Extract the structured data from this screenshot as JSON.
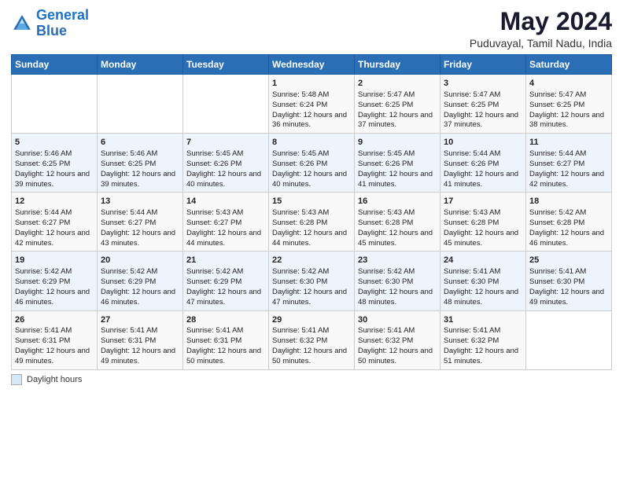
{
  "header": {
    "logo_line1": "General",
    "logo_line2": "Blue",
    "title": "May 2024",
    "subtitle": "Puduvayal, Tamil Nadu, India"
  },
  "columns": [
    "Sunday",
    "Monday",
    "Tuesday",
    "Wednesday",
    "Thursday",
    "Friday",
    "Saturday"
  ],
  "weeks": [
    [
      {
        "day": "",
        "sunrise": "",
        "sunset": "",
        "daylight": ""
      },
      {
        "day": "",
        "sunrise": "",
        "sunset": "",
        "daylight": ""
      },
      {
        "day": "",
        "sunrise": "",
        "sunset": "",
        "daylight": ""
      },
      {
        "day": "1",
        "sunrise": "Sunrise: 5:48 AM",
        "sunset": "Sunset: 6:24 PM",
        "daylight": "Daylight: 12 hours and 36 minutes."
      },
      {
        "day": "2",
        "sunrise": "Sunrise: 5:47 AM",
        "sunset": "Sunset: 6:25 PM",
        "daylight": "Daylight: 12 hours and 37 minutes."
      },
      {
        "day": "3",
        "sunrise": "Sunrise: 5:47 AM",
        "sunset": "Sunset: 6:25 PM",
        "daylight": "Daylight: 12 hours and 37 minutes."
      },
      {
        "day": "4",
        "sunrise": "Sunrise: 5:47 AM",
        "sunset": "Sunset: 6:25 PM",
        "daylight": "Daylight: 12 hours and 38 minutes."
      }
    ],
    [
      {
        "day": "5",
        "sunrise": "Sunrise: 5:46 AM",
        "sunset": "Sunset: 6:25 PM",
        "daylight": "Daylight: 12 hours and 39 minutes."
      },
      {
        "day": "6",
        "sunrise": "Sunrise: 5:46 AM",
        "sunset": "Sunset: 6:25 PM",
        "daylight": "Daylight: 12 hours and 39 minutes."
      },
      {
        "day": "7",
        "sunrise": "Sunrise: 5:45 AM",
        "sunset": "Sunset: 6:26 PM",
        "daylight": "Daylight: 12 hours and 40 minutes."
      },
      {
        "day": "8",
        "sunrise": "Sunrise: 5:45 AM",
        "sunset": "Sunset: 6:26 PM",
        "daylight": "Daylight: 12 hours and 40 minutes."
      },
      {
        "day": "9",
        "sunrise": "Sunrise: 5:45 AM",
        "sunset": "Sunset: 6:26 PM",
        "daylight": "Daylight: 12 hours and 41 minutes."
      },
      {
        "day": "10",
        "sunrise": "Sunrise: 5:44 AM",
        "sunset": "Sunset: 6:26 PM",
        "daylight": "Daylight: 12 hours and 41 minutes."
      },
      {
        "day": "11",
        "sunrise": "Sunrise: 5:44 AM",
        "sunset": "Sunset: 6:27 PM",
        "daylight": "Daylight: 12 hours and 42 minutes."
      }
    ],
    [
      {
        "day": "12",
        "sunrise": "Sunrise: 5:44 AM",
        "sunset": "Sunset: 6:27 PM",
        "daylight": "Daylight: 12 hours and 42 minutes."
      },
      {
        "day": "13",
        "sunrise": "Sunrise: 5:44 AM",
        "sunset": "Sunset: 6:27 PM",
        "daylight": "Daylight: 12 hours and 43 minutes."
      },
      {
        "day": "14",
        "sunrise": "Sunrise: 5:43 AM",
        "sunset": "Sunset: 6:27 PM",
        "daylight": "Daylight: 12 hours and 44 minutes."
      },
      {
        "day": "15",
        "sunrise": "Sunrise: 5:43 AM",
        "sunset": "Sunset: 6:28 PM",
        "daylight": "Daylight: 12 hours and 44 minutes."
      },
      {
        "day": "16",
        "sunrise": "Sunrise: 5:43 AM",
        "sunset": "Sunset: 6:28 PM",
        "daylight": "Daylight: 12 hours and 45 minutes."
      },
      {
        "day": "17",
        "sunrise": "Sunrise: 5:43 AM",
        "sunset": "Sunset: 6:28 PM",
        "daylight": "Daylight: 12 hours and 45 minutes."
      },
      {
        "day": "18",
        "sunrise": "Sunrise: 5:42 AM",
        "sunset": "Sunset: 6:28 PM",
        "daylight": "Daylight: 12 hours and 46 minutes."
      }
    ],
    [
      {
        "day": "19",
        "sunrise": "Sunrise: 5:42 AM",
        "sunset": "Sunset: 6:29 PM",
        "daylight": "Daylight: 12 hours and 46 minutes."
      },
      {
        "day": "20",
        "sunrise": "Sunrise: 5:42 AM",
        "sunset": "Sunset: 6:29 PM",
        "daylight": "Daylight: 12 hours and 46 minutes."
      },
      {
        "day": "21",
        "sunrise": "Sunrise: 5:42 AM",
        "sunset": "Sunset: 6:29 PM",
        "daylight": "Daylight: 12 hours and 47 minutes."
      },
      {
        "day": "22",
        "sunrise": "Sunrise: 5:42 AM",
        "sunset": "Sunset: 6:30 PM",
        "daylight": "Daylight: 12 hours and 47 minutes."
      },
      {
        "day": "23",
        "sunrise": "Sunrise: 5:42 AM",
        "sunset": "Sunset: 6:30 PM",
        "daylight": "Daylight: 12 hours and 48 minutes."
      },
      {
        "day": "24",
        "sunrise": "Sunrise: 5:41 AM",
        "sunset": "Sunset: 6:30 PM",
        "daylight": "Daylight: 12 hours and 48 minutes."
      },
      {
        "day": "25",
        "sunrise": "Sunrise: 5:41 AM",
        "sunset": "Sunset: 6:30 PM",
        "daylight": "Daylight: 12 hours and 49 minutes."
      }
    ],
    [
      {
        "day": "26",
        "sunrise": "Sunrise: 5:41 AM",
        "sunset": "Sunset: 6:31 PM",
        "daylight": "Daylight: 12 hours and 49 minutes."
      },
      {
        "day": "27",
        "sunrise": "Sunrise: 5:41 AM",
        "sunset": "Sunset: 6:31 PM",
        "daylight": "Daylight: 12 hours and 49 minutes."
      },
      {
        "day": "28",
        "sunrise": "Sunrise: 5:41 AM",
        "sunset": "Sunset: 6:31 PM",
        "daylight": "Daylight: 12 hours and 50 minutes."
      },
      {
        "day": "29",
        "sunrise": "Sunrise: 5:41 AM",
        "sunset": "Sunset: 6:32 PM",
        "daylight": "Daylight: 12 hours and 50 minutes."
      },
      {
        "day": "30",
        "sunrise": "Sunrise: 5:41 AM",
        "sunset": "Sunset: 6:32 PM",
        "daylight": "Daylight: 12 hours and 50 minutes."
      },
      {
        "day": "31",
        "sunrise": "Sunrise: 5:41 AM",
        "sunset": "Sunset: 6:32 PM",
        "daylight": "Daylight: 12 hours and 51 minutes."
      },
      {
        "day": "",
        "sunrise": "",
        "sunset": "",
        "daylight": ""
      }
    ]
  ],
  "footer": {
    "daylight_label": "Daylight hours"
  }
}
